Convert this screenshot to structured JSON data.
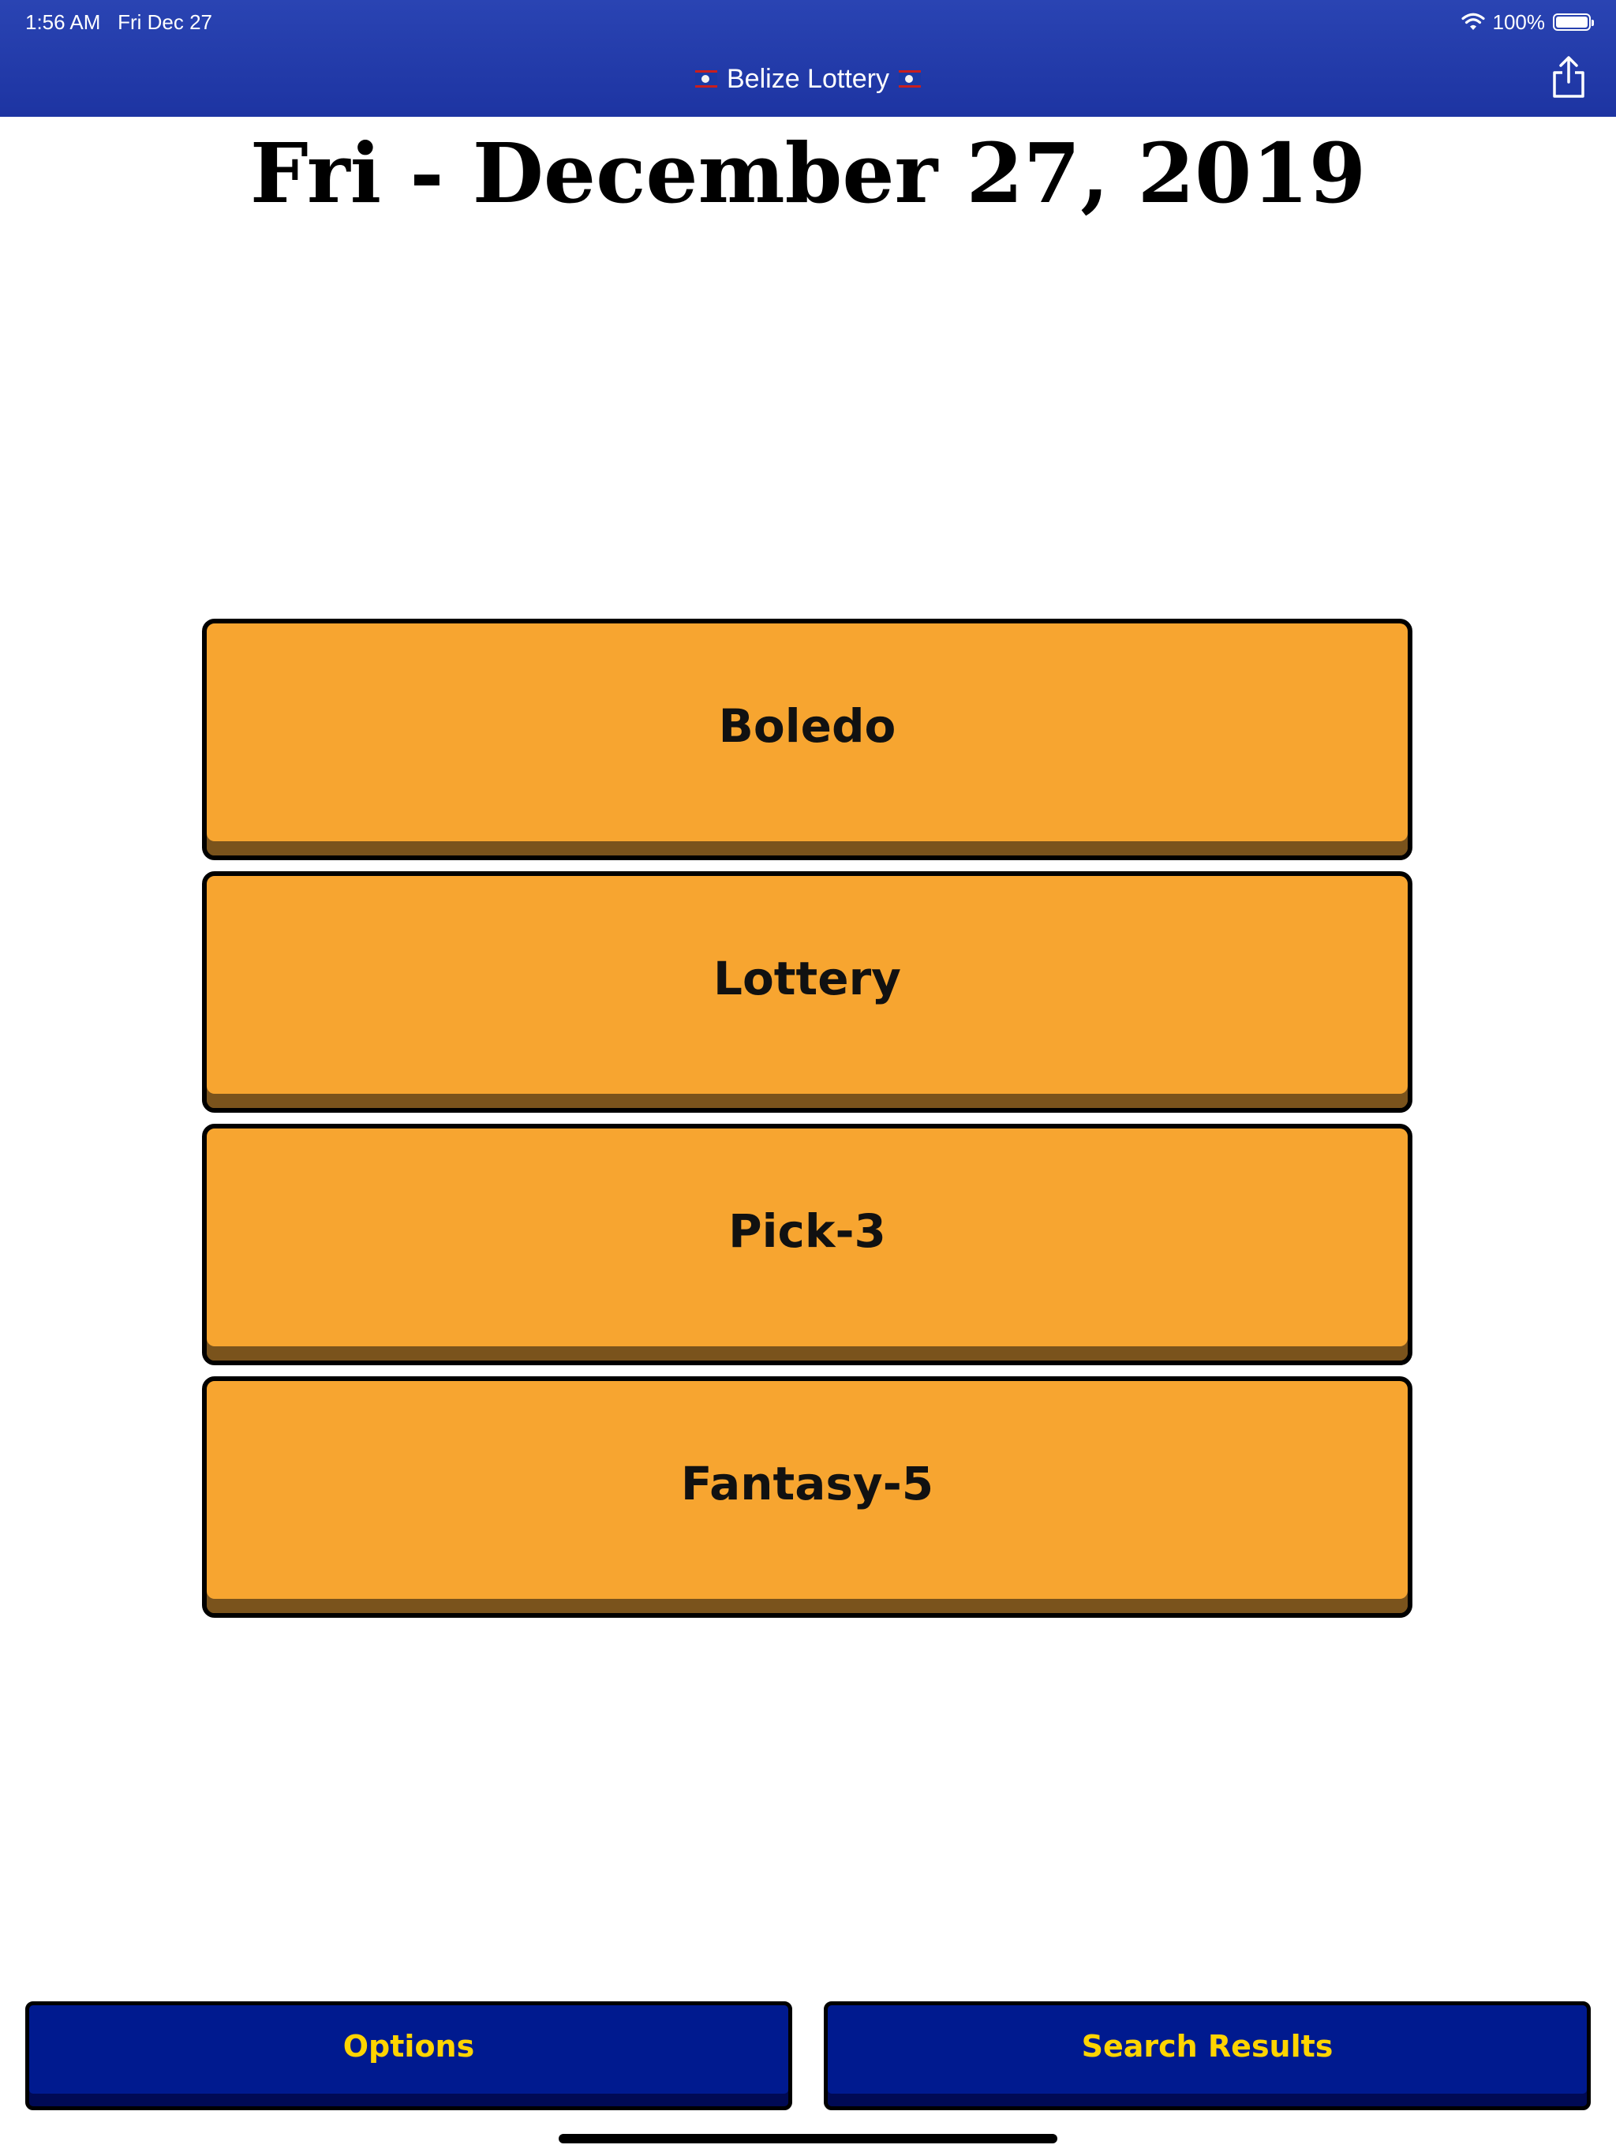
{
  "status_bar": {
    "time": "1:56 AM",
    "date": "Fri Dec 27",
    "battery": "100%"
  },
  "nav": {
    "title": "Belize Lottery",
    "share_icon": "share-icon"
  },
  "heading": "Fri - December 27, 2019",
  "games": [
    {
      "label": "Boledo"
    },
    {
      "label": "Lottery"
    },
    {
      "label": "Pick-3"
    },
    {
      "label": "Fantasy-5"
    }
  ],
  "bottom": {
    "options_label": "Options",
    "search_label": "Search Results"
  },
  "colors": {
    "nav_bg": "#1d34a2",
    "game_button": "#f7a530",
    "bottom_button": "#001a8f",
    "bottom_text": "#ffd400"
  }
}
